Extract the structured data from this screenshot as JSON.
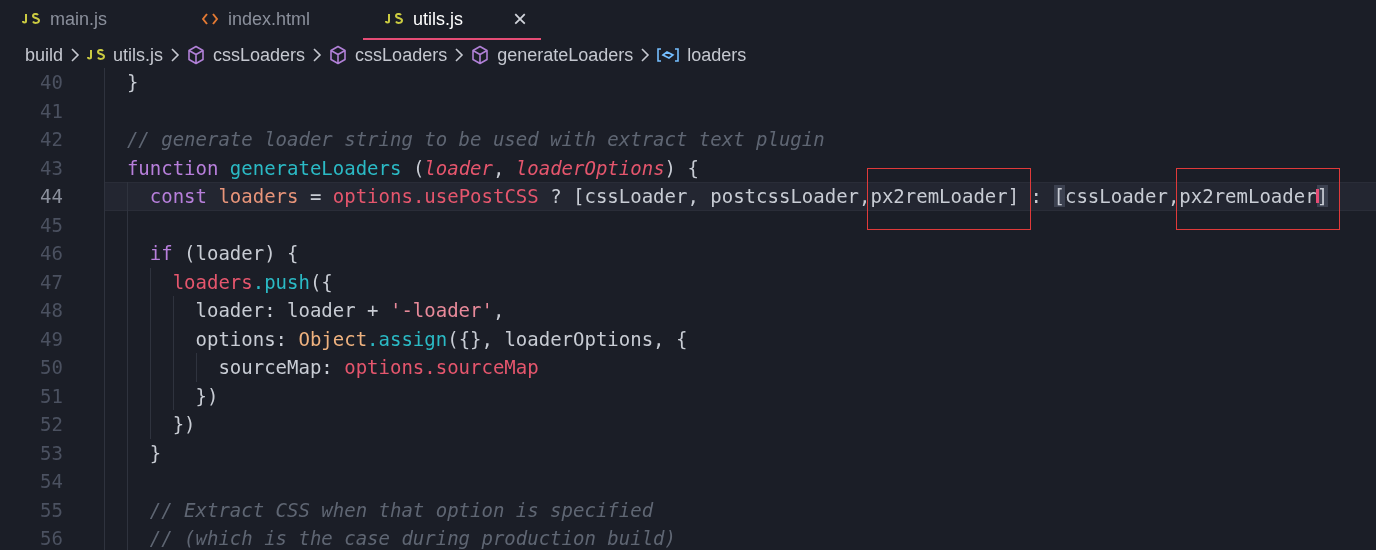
{
  "tabs": [
    {
      "label": "main.js",
      "kind": "js",
      "selected": false
    },
    {
      "label": "index.html",
      "kind": "html",
      "selected": false
    },
    {
      "label": "utils.js",
      "kind": "js",
      "selected": true,
      "close": "×"
    }
  ],
  "breadcrumbs": [
    {
      "label": "build"
    },
    {
      "label": "utils.js",
      "kind": "js"
    },
    {
      "label": "cssLoaders",
      "kind": "module"
    },
    {
      "label": "cssLoaders",
      "kind": "module"
    },
    {
      "label": "generateLoaders",
      "kind": "module"
    },
    {
      "label": "loaders",
      "kind": "variable"
    }
  ],
  "lines": [
    {
      "number": "40",
      "current": false,
      "tokens": [
        {
          "t": "  }",
          "kind": "plain"
        }
      ]
    },
    {
      "number": "41",
      "current": false
    },
    {
      "number": "42",
      "current": false,
      "tokens": [
        {
          "t": "  // generate loader string to be used with extract text plugin",
          "kind": "comment"
        }
      ]
    },
    {
      "number": "43",
      "current": false,
      "tokens": [
        {
          "t": "  function ",
          "kind": "keyword"
        },
        {
          "t": "generateLoaders",
          "kind": "function"
        },
        {
          "t": " (",
          "kind": "plain"
        },
        {
          "t": "loader",
          "kind": "param"
        },
        {
          "t": ", ",
          "kind": "plain"
        },
        {
          "t": "loaderOptions",
          "kind": "param"
        },
        {
          "t": ") {",
          "kind": "plain"
        }
      ]
    },
    {
      "number": "44",
      "current": true,
      "tokens": [
        {
          "t": "    const ",
          "kind": "keyword"
        },
        {
          "t": "loaders",
          "kind": "declaration"
        },
        {
          "t": " = ",
          "kind": "plain"
        },
        {
          "t": "options",
          "kind": "variable"
        },
        {
          "t": ".usePostCSS",
          "kind": "variable"
        },
        {
          "t": " ? [cssLoader, postcssLoader,",
          "kind": "plain"
        },
        {
          "t": "px2remLoader",
          "kind": "plain",
          "annotated": true
        },
        {
          "t": "] : ",
          "kind": "plain"
        },
        {
          "t": "[",
          "kind": "plain",
          "bracket_match": true
        },
        {
          "t": "cssLoader,",
          "kind": "plain"
        },
        {
          "t": "px2remLoader",
          "kind": "plain",
          "annotated": true
        },
        {
          "t": "]",
          "kind": "plain",
          "bracket_match": true,
          "cursor": true
        }
      ]
    },
    {
      "number": "45",
      "current": false
    },
    {
      "number": "46",
      "current": false,
      "tokens": [
        {
          "t": "    if",
          "kind": "keyword"
        },
        {
          "t": " (loader) {",
          "kind": "plain"
        }
      ]
    },
    {
      "number": "47",
      "current": false,
      "tokens": [
        {
          "t": "      loaders",
          "kind": "variable"
        },
        {
          "t": ".push",
          "kind": "function"
        },
        {
          "t": "({",
          "kind": "plain"
        }
      ]
    },
    {
      "number": "48",
      "current": false,
      "tokens": [
        {
          "t": "        loader: loader + ",
          "kind": "plain"
        },
        {
          "t": "'-loader'",
          "kind": "string"
        },
        {
          "t": ",",
          "kind": "plain"
        }
      ]
    },
    {
      "number": "49",
      "current": false,
      "tokens": [
        {
          "t": "        options: ",
          "kind": "plain"
        },
        {
          "t": "Object",
          "kind": "class"
        },
        {
          "t": ".assign",
          "kind": "function"
        },
        {
          "t": "({}, loaderOptions, {",
          "kind": "plain"
        }
      ]
    },
    {
      "number": "50",
      "current": false,
      "tokens": [
        {
          "t": "          sourceMap: ",
          "kind": "plain"
        },
        {
          "t": "options",
          "kind": "variable"
        },
        {
          "t": ".sourceMap",
          "kind": "variable"
        }
      ]
    },
    {
      "number": "51",
      "current": false,
      "tokens": [
        {
          "t": "        })",
          "kind": "plain"
        }
      ]
    },
    {
      "number": "52",
      "current": false,
      "tokens": [
        {
          "t": "      })",
          "kind": "plain"
        }
      ]
    },
    {
      "number": "53",
      "current": false,
      "tokens": [
        {
          "t": "    }",
          "kind": "plain"
        }
      ]
    },
    {
      "number": "54",
      "current": false
    },
    {
      "number": "55",
      "current": false,
      "tokens": [
        {
          "t": "    // Extract CSS when that option is specified",
          "kind": "comment"
        }
      ]
    },
    {
      "number": "56",
      "current": false,
      "tokens": [
        {
          "t": "    // (which is the case during production build)",
          "kind": "comment"
        }
      ]
    }
  ]
}
